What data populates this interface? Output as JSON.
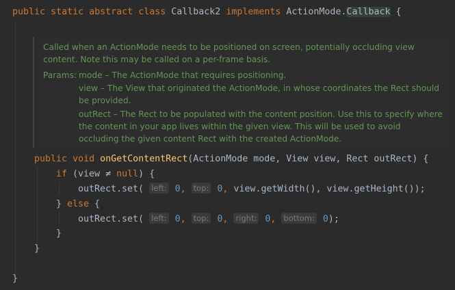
{
  "class_decl": {
    "kw_public": "public",
    "kw_static": "static",
    "kw_abstract": "abstract",
    "kw_class": "class",
    "class_name": "Callback2",
    "kw_implements": "implements",
    "iface_prefix": "ActionMode.",
    "iface_name": "Callback",
    "open_brace": "{"
  },
  "javadoc": {
    "desc_line1": "Called when an ActionMode needs to be positioned on screen, potentially occluding view",
    "desc_line2": "content. Note this may be called on a per-frame basis.",
    "params_label": "Params:",
    "param_mode": "mode – The ActionMode that requires positioning.",
    "param_view_1": "view – The View that originated the ActionMode, in whose coordinates the Rect should",
    "param_view_2": "be provided.",
    "param_outrect_1": "outRect – The Rect to be populated with the content position. Use this to specify where",
    "param_outrect_2": "the content in your app lives within the given view. This will be used to avoid",
    "param_outrect_3": "occluding the given content Rect with the created ActionMode."
  },
  "method": {
    "kw_public": "public",
    "kw_void": "void",
    "name": "onGetContentRect",
    "params": "(ActionMode mode, View view, Rect outRect) {",
    "if_kw": "if",
    "if_cond_open": " (view ",
    "neq": "≠",
    "null_kw": "null",
    "if_cond_close": ") {",
    "set_call_1": "outRect.set(",
    "hint_left": "left:",
    "zero": "0",
    "comma": ", ",
    "hint_top": "top:",
    "tail_1": "view.getWidth(), view.getHeight());",
    "close_else_open": "} ",
    "else_kw": "else",
    "else_brace": " {",
    "set_call_2": "outRect.set(",
    "hint_right": "right:",
    "hint_bottom": "bottom:",
    "tail_2": ");",
    "close_brace": "}",
    "method_close": "}",
    "class_close": "}"
  }
}
